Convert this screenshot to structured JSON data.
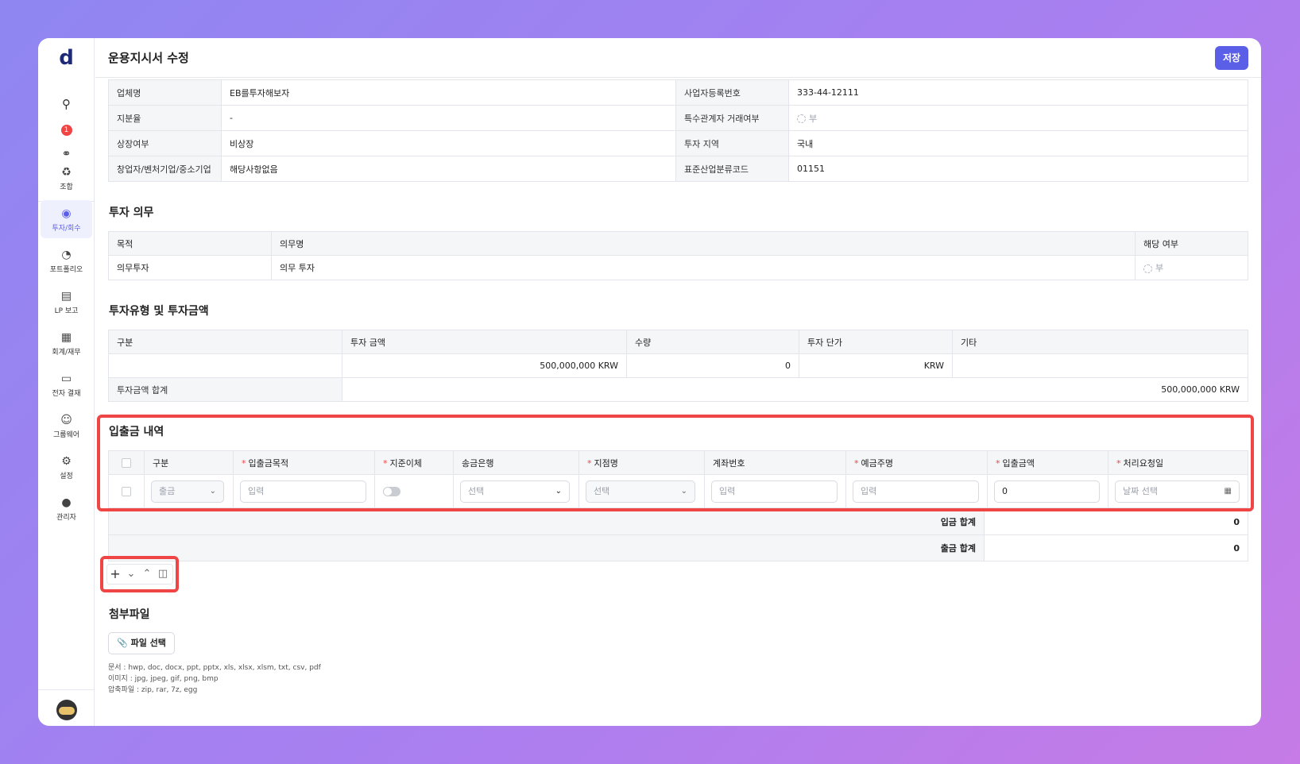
{
  "app": {
    "logo": "d",
    "notification_count": "1"
  },
  "sidebar": {
    "items": [
      {
        "label": "조합",
        "icon": "recycle-icon"
      },
      {
        "label": "투자/회수",
        "icon": "coins-icon",
        "active": true
      },
      {
        "label": "포트폴리오",
        "icon": "pie-chart-icon"
      },
      {
        "label": "LP 보고",
        "icon": "report-icon"
      },
      {
        "label": "회계/재무",
        "icon": "finance-doc-icon"
      },
      {
        "label": "전자 결재",
        "icon": "inbox-icon"
      },
      {
        "label": "그룹웨어",
        "icon": "users-icon"
      },
      {
        "label": "설정",
        "icon": "settings-icon"
      },
      {
        "label": "관리자",
        "icon": "admin-icon"
      }
    ]
  },
  "header": {
    "title": "운용지시서 수정",
    "save_label": "저장"
  },
  "company": {
    "rows": [
      {
        "k1": "업체명",
        "v1": "EB를투자해보자",
        "k2": "사업자등록번호",
        "v2": "333-44-12111"
      },
      {
        "k1": "지분율",
        "v1": "-",
        "k2": "특수관계자 거래여부",
        "v2": "부"
      },
      {
        "k1": "상장여부",
        "v1": "비상장",
        "k2": "투자 지역",
        "v2": "국내"
      },
      {
        "k1": "창업자/벤처기업/중소기업",
        "v1": "해당사항없음",
        "k2": "표준산업분류코드",
        "v2": "01151"
      }
    ]
  },
  "obligation": {
    "title": "투자 의무",
    "headers": [
      "목적",
      "의무명",
      "해당 여부"
    ],
    "row": {
      "purpose": "의무투자",
      "name": "의무 투자",
      "applicable": "부"
    }
  },
  "investment": {
    "title": "투자유형 및 투자금액",
    "headers": [
      "구분",
      "투자 금액",
      "수량",
      "투자 단가",
      "기타"
    ],
    "row": {
      "category": "",
      "amount": "500,000,000 KRW",
      "quantity": "0",
      "unit_price": "KRW",
      "etc": ""
    },
    "total_label": "투자금액 합계",
    "total_value": "500,000,000 KRW"
  },
  "deposits": {
    "title": "입출금 내역",
    "headers": {
      "category": "구분",
      "purpose": "입출금목적",
      "standard_transfer": "지준이체",
      "bank": "송금은행",
      "branch": "지점명",
      "account": "계좌번호",
      "holder": "예금주명",
      "amount": "입출금액",
      "request_date": "처리요청일"
    },
    "row": {
      "category": "출금",
      "purpose_placeholder": "입력",
      "bank": "선택",
      "branch": "선택",
      "account_placeholder": "입력",
      "holder_placeholder": "입력",
      "amount": "0",
      "date_placeholder": "날짜 선택"
    },
    "deposit_total_label": "입금 합계",
    "deposit_total": "0",
    "withdraw_total_label": "출금 합계",
    "withdraw_total": "0"
  },
  "attachments": {
    "title": "첨부파일",
    "button_label": "파일 선택",
    "doc_ext": "문서 : hwp, doc, docx, ppt, pptx, xls, xlsx, xlsm, txt, csv, pdf",
    "img_ext": "이미지 : jpg, jpeg, gif, png, bmp",
    "zip_ext": "압축파일 : zip, rar, 7z, egg"
  },
  "colors": {
    "accent": "#5b5fe8",
    "highlight": "#f04545"
  }
}
